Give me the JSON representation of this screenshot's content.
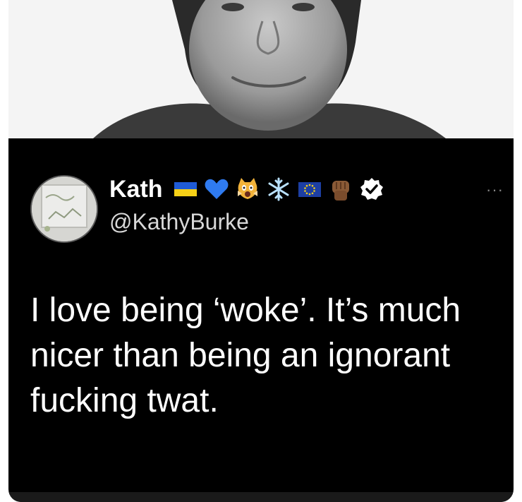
{
  "tweet": {
    "display_name": "Kath",
    "handle": "@KathyBurke",
    "text": "I love being ‘woke’. It’s much nicer than being an ignorant fucking twat.",
    "more_label": "···"
  },
  "emojis": [
    "ukraine-flag-icon",
    "blue-heart-icon",
    "screaming-cat-icon",
    "snowflake-icon",
    "eu-flag-icon",
    "raised-fist-icon",
    "verified-badge-icon"
  ],
  "colors": {
    "background": "#000000",
    "text": "#ffffff",
    "handle": "#d8d8d8",
    "ukraine_blue": "#1f5bd6",
    "ukraine_yellow": "#f7d117",
    "heart_blue": "#2f7bf0",
    "eu_blue": "#1d3fa3",
    "eu_star": "#f7d117"
  }
}
